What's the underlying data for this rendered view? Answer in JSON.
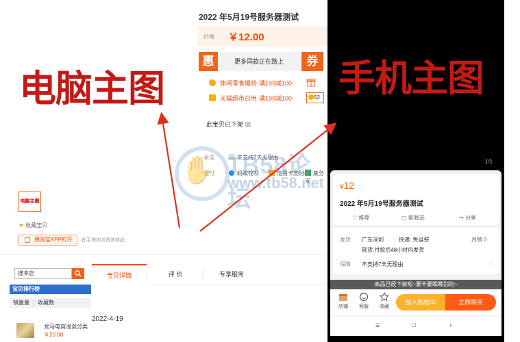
{
  "product": {
    "title": "2022 年5月19号服务器测试",
    "price_label": "价格",
    "price_value": "￥12.00",
    "hui_label": "惠",
    "coupon_text": "更多同款正在路上",
    "quan_label": "券",
    "promo1": "休闲零食爆抢-满199减100",
    "promo2": "天猫超市日用-满199减100",
    "promo_box_text": "52",
    "status": "此宝贝已下架"
  },
  "details": {
    "row1_label": "承诺",
    "row1_value": "不支持7天无理由",
    "row2_label": "支付",
    "pay1": "蚂蚁花呗",
    "pay2": "信用卡支付",
    "pay3": "集分宝"
  },
  "shop": {
    "logo_text": "电脑主图",
    "favorite": "收藏宝贝",
    "open_app": "用淘宝APP打开",
    "open_app_note": "在手淘内浏览该商品"
  },
  "sidebar": {
    "search_value": "搜本店",
    "rank_title": "宝贝排行榜",
    "rank_tabs": [
      "销量量",
      "收藏数"
    ],
    "item_name": "龙马电商浅谈分类",
    "item_price": "￥20.00"
  },
  "tabs": [
    "宝贝详情",
    "评 价",
    "专享服务"
  ],
  "detail_date": "2022-4-19",
  "annotations": {
    "left": "电脑主图",
    "right": "手机主图",
    "color": "#c41a16"
  },
  "watermark": {
    "title": "TB58论坛",
    "url": "www.tb58.net"
  },
  "mobile": {
    "page_indicator": "1/1",
    "price_symbol": "¥",
    "price": "12",
    "title": "2022 年5月19号服务器测试",
    "actions": [
      "推荐",
      "帮我选",
      "分享"
    ],
    "ship_label": "发货",
    "ship_from": "广东深圳",
    "express": "快递: 免运费",
    "monthly_sales": "月销 0",
    "ship_note": "现货,付款后48小时内发货",
    "guarantee_label": "保障",
    "guarantee_value": "不支持7天无理由",
    "banner": "商品已经下架啦~要不要瞧瞧别的~",
    "bottom": [
      "店铺",
      "客服",
      "收藏"
    ],
    "cart_button": "加入购物车",
    "buy_button": "立即购买",
    "accent": "#ff5a16"
  }
}
